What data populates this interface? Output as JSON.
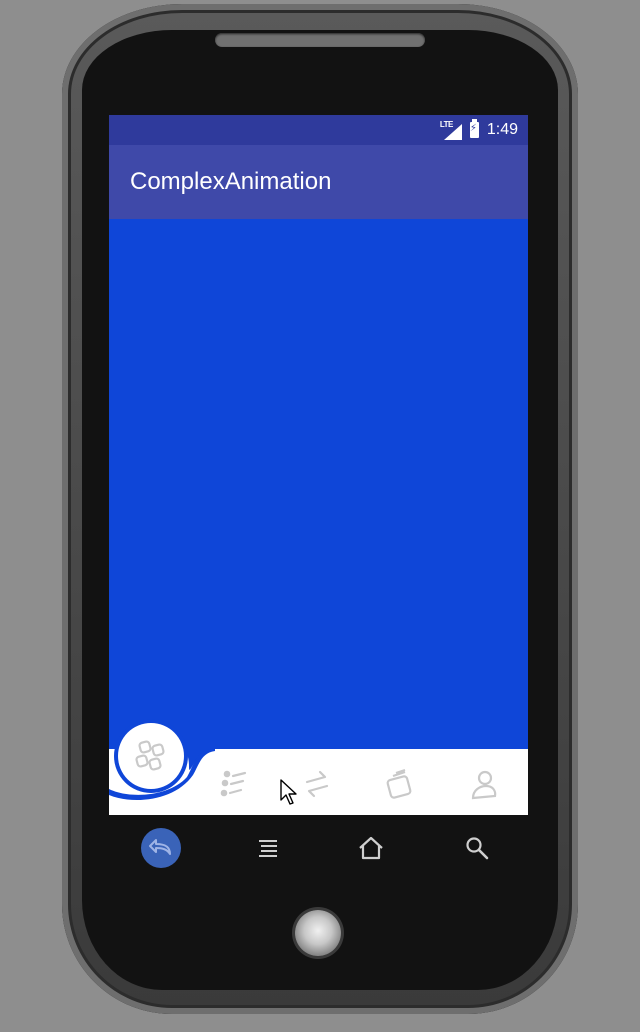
{
  "status_bar": {
    "network_label": "LTE",
    "time": "1:49"
  },
  "app_bar": {
    "title": "ComplexAnimation"
  },
  "colors": {
    "status_bar": "#2f3a9c",
    "app_bar": "#3f49a9",
    "content": "#0f46d8",
    "bottom_nav": "#ffffff",
    "nav_icon": "#c9c9c9"
  },
  "bottom_nav": {
    "items": [
      {
        "icon": "grid-icon",
        "selected": true
      },
      {
        "icon": "list-icon",
        "selected": false
      },
      {
        "icon": "swap-icon",
        "selected": false
      },
      {
        "icon": "wallet-icon",
        "selected": false
      },
      {
        "icon": "person-icon",
        "selected": false
      }
    ]
  },
  "system_nav": {
    "buttons": [
      "back-icon",
      "menu-icon",
      "home-icon",
      "search-icon"
    ]
  }
}
